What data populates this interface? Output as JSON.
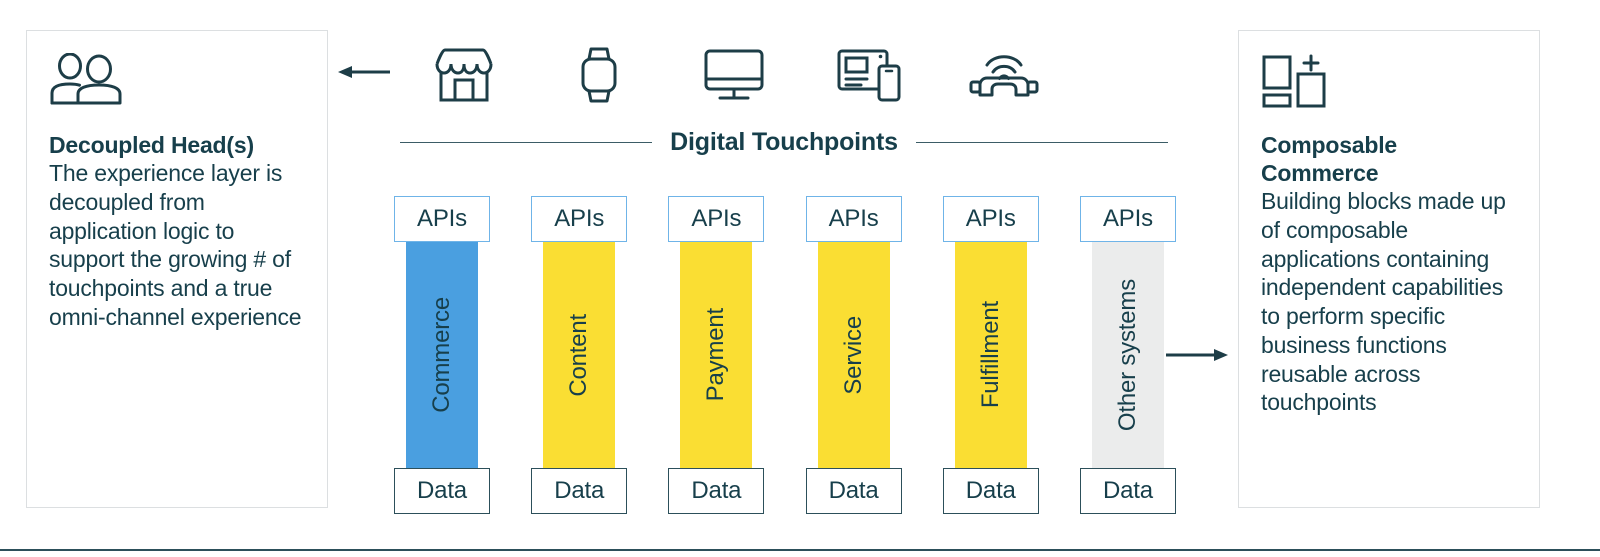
{
  "left_panel": {
    "icon": "two-people-icon",
    "title": "Decoupled Head(s)",
    "body": "The experience layer is decoupled from application logic to support the growing # of touchpoints and a true omni-channel experience"
  },
  "right_panel": {
    "icon": "building-blocks-plus-icon",
    "title": "Composable Commerce",
    "body": "Building blocks made up of composable applications containing independent capabilities to perform specific business functions reusable across touchpoints"
  },
  "touchpoints": {
    "label": "Digital Touchpoints",
    "icons": [
      {
        "name": "storefront-icon"
      },
      {
        "name": "smartwatch-icon"
      },
      {
        "name": "desktop-monitor-icon"
      },
      {
        "name": "tablet-and-mobile-icon"
      },
      {
        "name": "connected-car-wifi-icon"
      }
    ]
  },
  "arrows": {
    "inbound": "arrow-left-icon",
    "outbound": "arrow-right-icon"
  },
  "columns": {
    "api_label": "APIs",
    "data_label": "Data",
    "items": [
      {
        "label": "Commerce",
        "color": "#4a9fe0"
      },
      {
        "label": "Content",
        "color": "#fade33"
      },
      {
        "label": "Payment",
        "color": "#fade33"
      },
      {
        "label": "Service",
        "color": "#fade33"
      },
      {
        "label": "Fulfillment",
        "color": "#fade33"
      },
      {
        "label": "Other systems",
        "color": "#ebecec"
      }
    ]
  },
  "colors": {
    "ink": "#173f4b",
    "api_border": "#6fb4e8",
    "data_border": "#2c4f5a",
    "panel_border": "#dcdfe1",
    "accent_blue": "#4a9fe0",
    "accent_yellow": "#fade33",
    "neutral_gray": "#ebecec"
  }
}
